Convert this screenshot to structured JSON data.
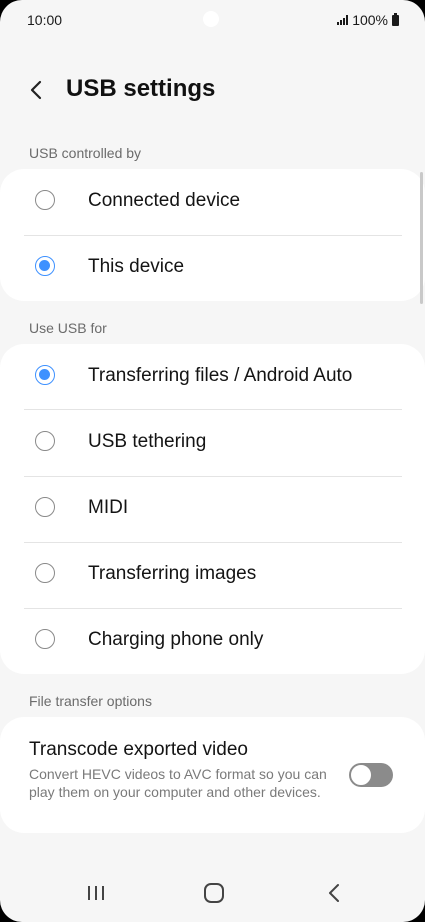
{
  "status_bar": {
    "time": "10:00",
    "battery": "100%"
  },
  "header": {
    "title": "USB settings"
  },
  "controlled_by": {
    "heading": "USB controlled by",
    "options": [
      {
        "label": "Connected device",
        "selected": false
      },
      {
        "label": "This device",
        "selected": true
      }
    ]
  },
  "use_usb_for": {
    "heading": "Use USB for",
    "options": [
      {
        "label": "Transferring files / Android Auto",
        "selected": true
      },
      {
        "label": "USB tethering",
        "selected": false
      },
      {
        "label": "MIDI",
        "selected": false
      },
      {
        "label": "Transferring images",
        "selected": false
      },
      {
        "label": "Charging phone only",
        "selected": false
      }
    ]
  },
  "file_transfer": {
    "heading": "File transfer options",
    "transcode": {
      "title": "Transcode exported video",
      "description": "Convert HEVC videos to AVC format so you can play them on your computer and other devices.",
      "enabled": false
    }
  },
  "colors": {
    "accent": "#3e91ff",
    "background": "#f6f6f6",
    "card": "#ffffff"
  },
  "nav_bar": {
    "icons": [
      "recent-apps-icon",
      "home-icon",
      "back-icon"
    ]
  }
}
